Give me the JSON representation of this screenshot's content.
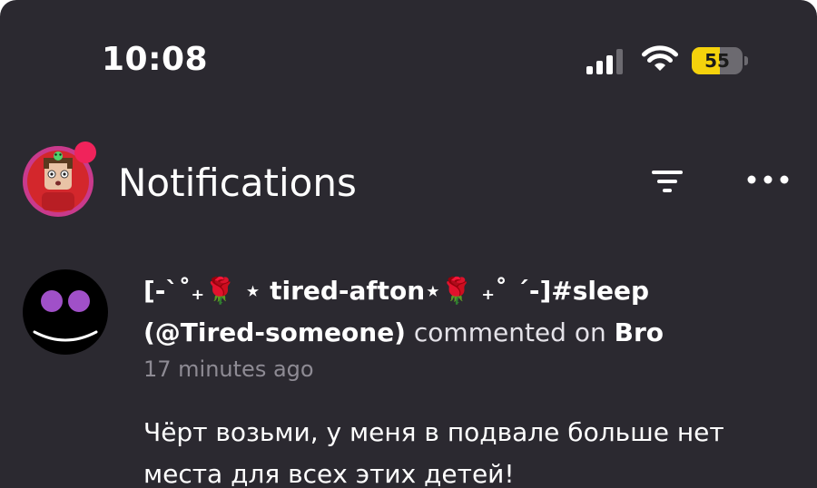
{
  "status_bar": {
    "time": "10:08",
    "battery_level": "55",
    "battery_percent": 0.55,
    "icons": [
      "cellular-signal-icon",
      "wifi-icon",
      "battery-icon"
    ]
  },
  "header": {
    "title": "Notifications",
    "icons": [
      "profile-avatar",
      "filter-icon",
      "more-icon"
    ],
    "badge_color": "#f0235b"
  },
  "notification": {
    "actor_name": "[-ˋ˚₊🌹 ⋆ tired-afton⋆🌹 ₊˚ ˊ-]#sleep",
    "actor_handle": "(@Tired-someone)",
    "action": "commented on",
    "target": "Bro",
    "time_ago": "17 minutes ago",
    "comment": "Чёрт возьми, у меня в подвале больше нет места для всех этих детей!"
  },
  "colors": {
    "background": "#2b2930",
    "battery_fill": "#f5d20c",
    "avatar_eye": "#a050c8",
    "secondary_text": "#8e8b94"
  }
}
